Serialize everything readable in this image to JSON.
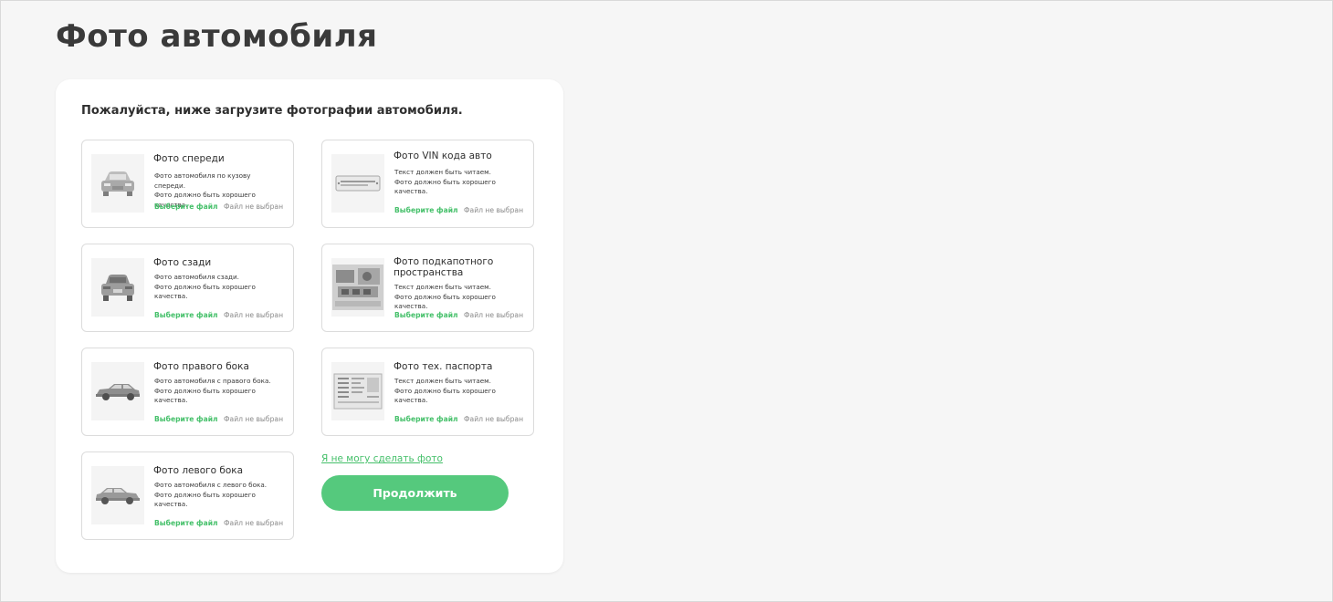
{
  "page": {
    "title": "Фото автомобиля"
  },
  "form": {
    "subtitle": "Пожалуйста, ниже загрузите фотографии автомобиля.",
    "choose_label": "Выберите файл",
    "no_file_label": "Файл не выбран",
    "cant_photo_link": "Я не могу сделать фото",
    "continue_label": "Продолжить",
    "accent_color": "#55c97d",
    "uploads": [
      {
        "title": "Фото спереди",
        "desc": [
          "Фото автомобиля по кузову спереди.",
          "Фото должно быть хорошего качества."
        ],
        "icon": "car-front-icon"
      },
      {
        "title": "Фото VIN кода авто",
        "desc": [
          "Текст должен быть читаем.",
          "Фото должно быть хорошего",
          "качества."
        ],
        "icon": "vin-plate-icon"
      },
      {
        "title": "Фото сзади",
        "desc": [
          "Фото автомобиля сзади.",
          "Фото должно быть хорошего",
          "качества."
        ],
        "icon": "car-rear-icon"
      },
      {
        "title": "Фото подкапотного пространства",
        "desc": [
          "Текст должен быть читаем.",
          "Фото должно быть хорошего",
          "качества."
        ],
        "icon": "engine-bay-icon"
      },
      {
        "title": "Фото правого бока",
        "desc": [
          "Фото автомобиля с правого бока.",
          "Фото должно быть хорошего",
          "качества."
        ],
        "icon": "car-right-side-icon"
      },
      {
        "title": "Фото тех. паспорта",
        "desc": [
          "Текст должен быть читаем.",
          "Фото должно быть хорошего",
          "качества."
        ],
        "icon": "registration-document-icon"
      },
      {
        "title": "Фото левого бока",
        "desc": [
          "Фото автомобиля с левого бока.",
          "Фото должно быть хорошего",
          "качества."
        ],
        "icon": "car-left-side-icon"
      }
    ]
  }
}
